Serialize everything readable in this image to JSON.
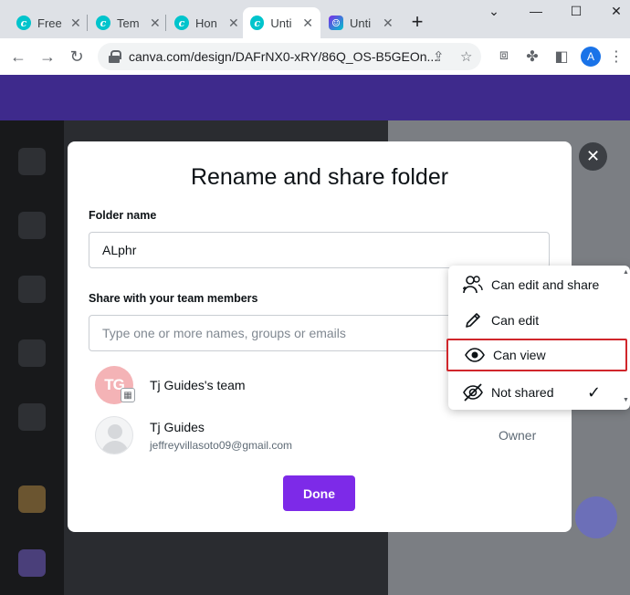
{
  "browser": {
    "tabs": [
      {
        "label": "Free",
        "favicon": "canva-icon",
        "active": false
      },
      {
        "label": "Tem",
        "favicon": "canva-icon",
        "active": false
      },
      {
        "label": "Hon",
        "favicon": "canva-icon",
        "active": false
      },
      {
        "label": "Unti",
        "favicon": "canva-icon",
        "active": true
      },
      {
        "label": "Unti",
        "favicon": "canva-app-icon",
        "active": false
      }
    ],
    "url": "canva.com/design/DAFrNX0-xRY/86Q_OS-B5GEOn...",
    "profile_initial": "A"
  },
  "modal": {
    "title": "Rename and share folder",
    "folder_name_label": "Folder name",
    "folder_name_value": "ALphr",
    "share_label": "Share with your team members",
    "share_placeholder": "Type one or more names, groups or emails",
    "members": [
      {
        "avatar_text": "TG",
        "name": "Tj Guides's team",
        "email": "",
        "role": ""
      },
      {
        "avatar_text": "",
        "name": "Tj Guides",
        "email": "jeffreyvillasoto09@gmail.com",
        "role": "Owner"
      }
    ],
    "done_label": "Done"
  },
  "permission_menu": {
    "items": [
      {
        "label": "Can edit and share",
        "icon": "people-edit-icon",
        "checked": false
      },
      {
        "label": "Can edit",
        "icon": "pencil-icon",
        "checked": false
      },
      {
        "label": "Can view",
        "icon": "eye-icon",
        "checked": false,
        "highlighted": true
      },
      {
        "label": "Not shared",
        "icon": "eye-off-icon",
        "checked": true
      }
    ]
  },
  "colors": {
    "primary": "#7d2ae8",
    "highlight_border": "#d0262b",
    "canva_teal": "#00c4cc"
  }
}
